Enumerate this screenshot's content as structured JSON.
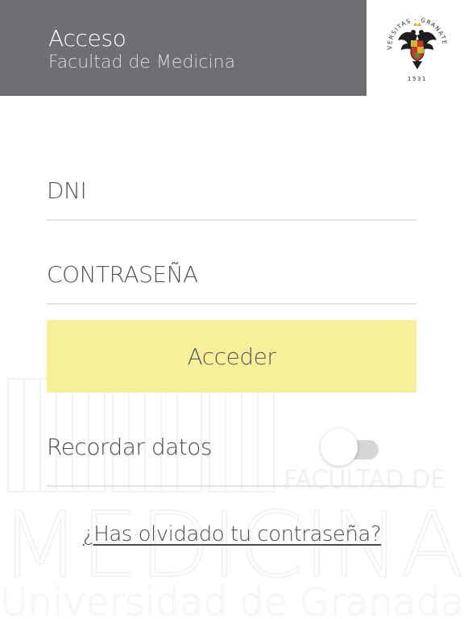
{
  "header": {
    "title": "Acceso",
    "subtitle": "Facultad de Medicina"
  },
  "seal": {
    "text_top": "UNIVERSITAS · GRANATENSIS",
    "year": "1531",
    "icon": "university-seal-icon"
  },
  "form": {
    "dni_placeholder": "DNI",
    "dni_value": "",
    "password_placeholder": "CONTRASEÑA",
    "password_value": "",
    "submit_label": "Acceder",
    "submit_color": "#f7ef9a",
    "remember_label": "Recordar datos",
    "remember_on": false,
    "forgot_link": "¿Has olvidado tu contraseña?"
  },
  "watermark": {
    "line1": "FACULTAD DE",
    "line2": "MEDICINA",
    "line3": "Universidad de Granada"
  },
  "colors": {
    "header_bg": "#6f6e73",
    "accent_yellow": "#f7ef9a",
    "divider": "#e2e2e2"
  }
}
